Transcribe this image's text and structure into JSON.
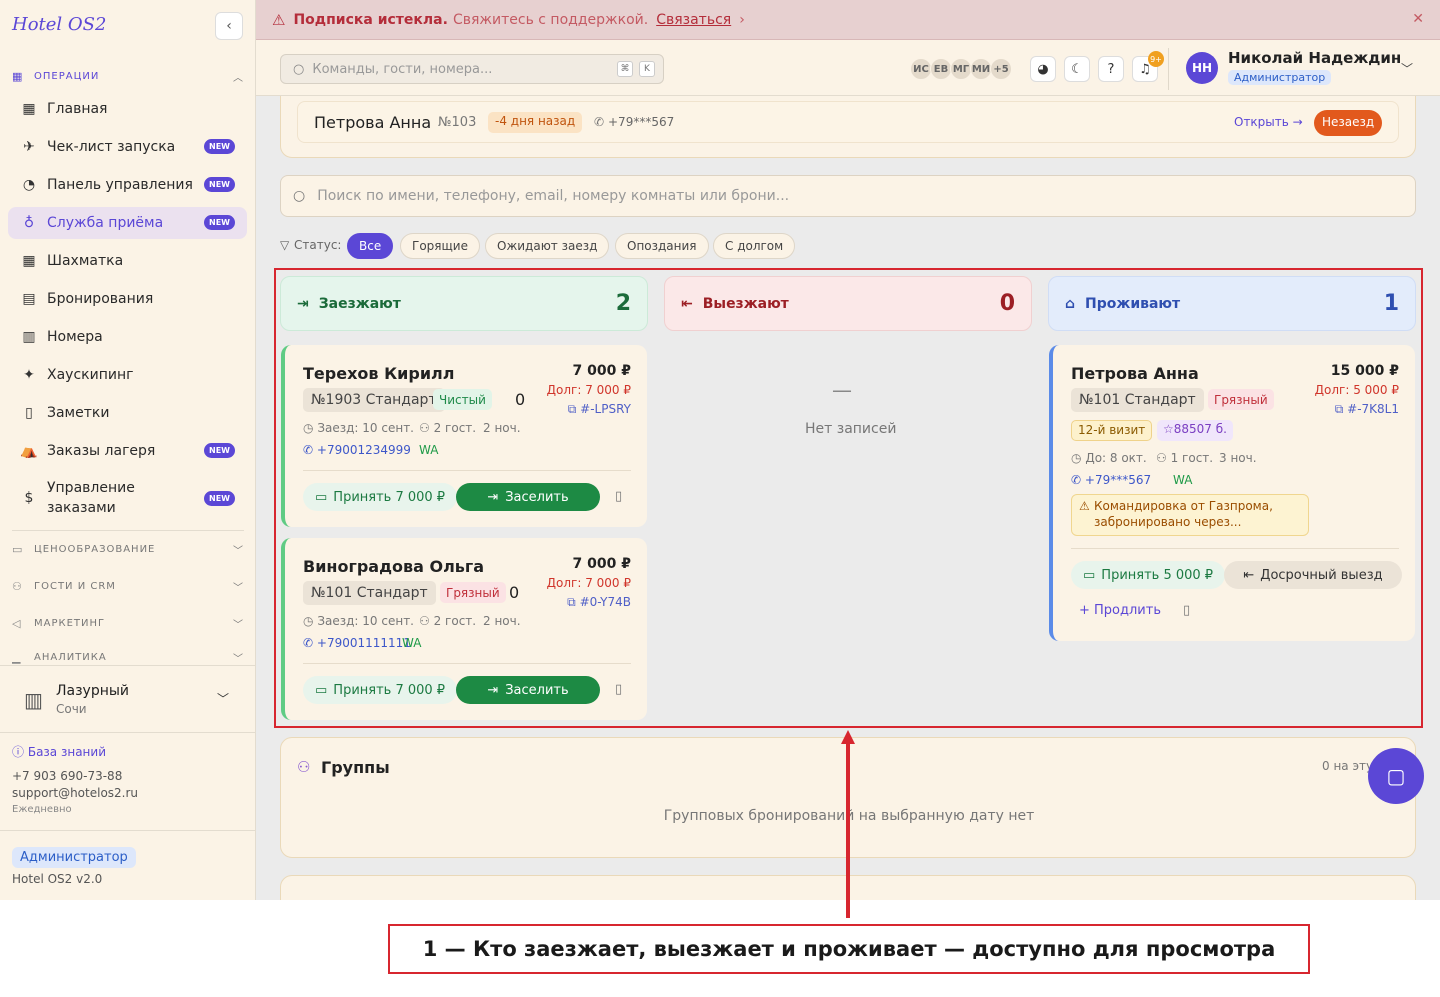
{
  "sidebar": {
    "logo": "Hotel OS2",
    "collapse_icon": "chevron-left-icon",
    "operations_header": "ОПЕРАЦИИ",
    "items": [
      {
        "label": "Главная",
        "icon": "dashboard-icon",
        "badge": ""
      },
      {
        "label": "Чек-лист запуска",
        "icon": "rocket-icon",
        "badge": "NEW"
      },
      {
        "label": "Панель управления",
        "icon": "gauge-icon",
        "badge": "NEW"
      },
      {
        "label": "Служба приёма",
        "icon": "bell-icon",
        "badge": "NEW"
      },
      {
        "label": "Шахматка",
        "icon": "grid-icon",
        "badge": ""
      },
      {
        "label": "Бронирования",
        "icon": "clipboard-icon",
        "badge": ""
      },
      {
        "label": "Номера",
        "icon": "building-icon",
        "badge": ""
      },
      {
        "label": "Хаускипинг",
        "icon": "sparkles-icon",
        "badge": ""
      },
      {
        "label": "Заметки",
        "icon": "note-icon",
        "badge": ""
      },
      {
        "label": "Заказы лагеря",
        "icon": "tent-icon",
        "badge": "NEW"
      },
      {
        "label": "Управление\nзаказами",
        "icon": "dollar-icon",
        "badge": "NEW"
      }
    ],
    "sections": [
      "ЦЕНООБРАЗОВАНИЕ",
      "ГОСТИ И CRM",
      "МАРКЕТИНГ",
      "АНАЛИТИКА"
    ],
    "hotel": {
      "name": "Лазурный",
      "city": "Сочи"
    },
    "kb_link": "База знаний",
    "phone": "+7 903 690-73-88",
    "email": "support@hotelos2.ru",
    "schedule": "Ежедневно",
    "role": "Администратор",
    "version": "Hotel OS2 v2.0"
  },
  "banner": {
    "title": "Подписка истекла.",
    "text": "Свяжитесь с поддержкой.",
    "link": "Связаться"
  },
  "topbar": {
    "search_placeholder": "Команды, гости, номера...",
    "kbd1": "⌘",
    "kbd2": "K",
    "avatars": [
      "ИС",
      "ЕВ",
      "МГ",
      "МИ"
    ],
    "more": "+5",
    "notif_count": "9+",
    "user_initials": "НН",
    "user_name": "Николай Надеждин",
    "user_role": "Администратор"
  },
  "late_guest": {
    "name": "Петрова Анна",
    "room": "№103",
    "late": "-4 дня назад",
    "phone": "+79***567",
    "open": "Открыть →",
    "status": "Незаезд"
  },
  "main_search_placeholder": "Поиск по имени, телефону, email, номеру комнаты или брони...",
  "filters": {
    "label": "Статус:",
    "chips": [
      "Все",
      "Горящие",
      "Ожидают заезд",
      "Опоздания",
      "С долгом"
    ]
  },
  "columns": {
    "arriving": {
      "title": "Заезжают",
      "count": "2"
    },
    "departing": {
      "title": "Выезжают",
      "count": "0",
      "empty_dash": "—",
      "empty": "Нет записей"
    },
    "staying": {
      "title": "Проживают",
      "count": "1"
    }
  },
  "arrivals": [
    {
      "name": "Терехов Кирилл",
      "room": "№1903 Стандарт",
      "status": "Чистый",
      "zero": "0",
      "price": "7 000 ₽",
      "debt": "Долг: 7 000 ₽",
      "ref": "#-LPSRY",
      "checkin": "Заезд: 10 сент.",
      "guests": "2 гост.",
      "nights": "2 ноч.",
      "phone": "+79001234999",
      "wa": "WA",
      "pay": "Принять 7 000 ₽",
      "checkin_btn": "Заселить"
    },
    {
      "name": "Виноградова Ольга",
      "room": "№101 Стандарт",
      "status": "Грязный",
      "zero": "0",
      "price": "7 000 ₽",
      "debt": "Долг: 7 000 ₽",
      "ref": "#0-Y74B",
      "checkin": "Заезд: 10 сент.",
      "guests": "2 гост.",
      "nights": "2 ноч.",
      "phone": "+79001111111",
      "wa": "WA",
      "pay": "Принять 7 000 ₽",
      "checkin_btn": "Заселить"
    }
  ],
  "staying_guest": {
    "name": "Петрова Анна",
    "room": "№101 Стандарт",
    "status": "Грязный",
    "price": "15 000 ₽",
    "debt": "Долг: 5 000 ₽",
    "ref": "#-7K8L1",
    "visit": "12-й визит",
    "points": "88507 б.",
    "until": "До: 8 окт.",
    "guests": "1 гост.",
    "nights": "3 ноч.",
    "phone": "+79***567",
    "wa": "WA",
    "note": "Командировка от Газпрома, забронировано через...",
    "pay": "Принять 5 000 ₽",
    "early": "Досрочный выезд",
    "extend": "+ Продлить"
  },
  "groups": {
    "title": "Группы",
    "meta": "0 на эту",
    "empty": "Групповых бронирований на выбранную дату нет"
  },
  "colors": {
    "accent": "#5b47d6",
    "green": "#1d8a44",
    "red": "#d0352b",
    "annotation": "#d7262f"
  },
  "caption": "1 — Кто заезжает, выезжает и проживает — доступно для просмотра"
}
